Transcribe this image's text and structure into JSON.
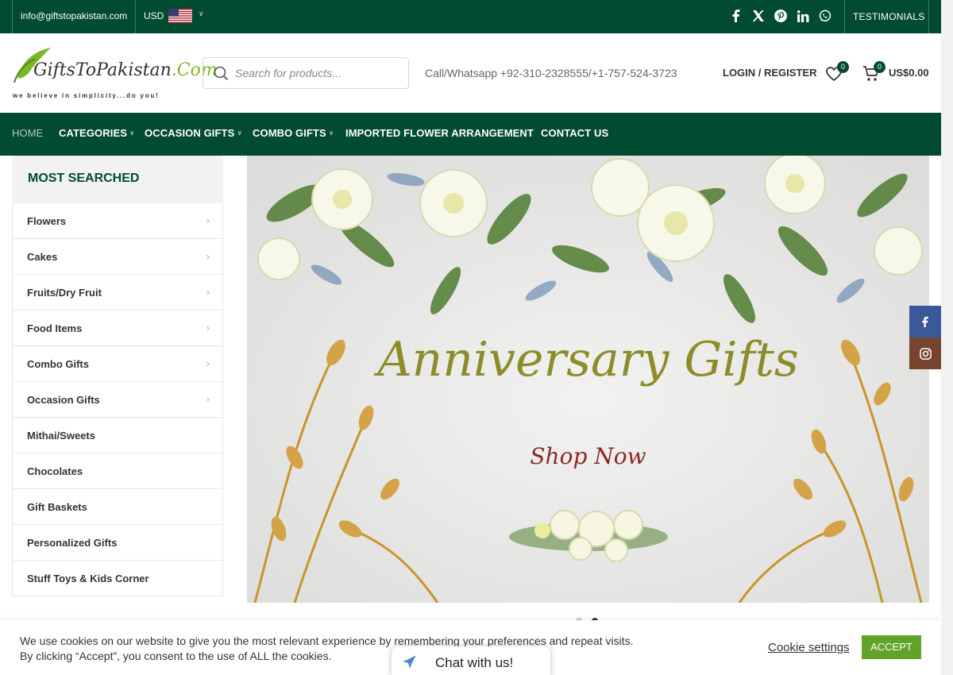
{
  "topbar": {
    "email": "info@giftstopakistan.com",
    "currency": "USD",
    "testimonials": "TESTIMONIALS",
    "social": [
      "facebook-icon",
      "x-icon",
      "pinterest-icon",
      "linkedin-icon",
      "whatsapp-icon"
    ]
  },
  "header": {
    "logo_text": "GiftsToPakistan",
    "logo_com": ".Com",
    "logo_tagline": "we believe in simplicity...do you!",
    "search_placeholder": "Search for products...",
    "call": "Call/Whatsapp +92-310-2328555/+1-757-524-3723",
    "login": "LOGIN / REGISTER",
    "wishlist_count": "0",
    "cart_count": "0",
    "cart_total": "US$0.00"
  },
  "nav": {
    "home": "HOME",
    "categories": "CATEGORIES",
    "occasion": "OCCASION GIFTS",
    "combo": "COMBO GIFTS",
    "imported": "IMPORTED FLOWER ARRANGEMENT",
    "contact": "CONTACT US"
  },
  "sidebar": {
    "title": "MOST SEARCHED",
    "items": [
      {
        "label": "Flowers",
        "has_arrow": true
      },
      {
        "label": "Cakes",
        "has_arrow": true
      },
      {
        "label": "Fruits/Dry Fruit",
        "has_arrow": true
      },
      {
        "label": "Food Items",
        "has_arrow": true
      },
      {
        "label": "Combo Gifts",
        "has_arrow": true
      },
      {
        "label": "Occasion Gifts",
        "has_arrow": true
      },
      {
        "label": "Mithai/Sweets",
        "has_arrow": false
      },
      {
        "label": "Chocolates",
        "has_arrow": false
      },
      {
        "label": "Gift Baskets",
        "has_arrow": false
      },
      {
        "label": "Personalized Gifts",
        "has_arrow": false
      },
      {
        "label": "Stuff Toys & Kids Corner",
        "has_arrow": false
      }
    ]
  },
  "banner": {
    "title": "Anniversary Gifts",
    "cta": "Shop Now"
  },
  "cookie": {
    "message": "We use cookies on our website to give you the most relevant experience by remembering your preferences and repeat visits. By clicking “Accept”, you consent to the use of ALL the cookies.",
    "settings": "Cookie settings",
    "accept": "ACCEPT"
  },
  "chat": {
    "label": "Chat with us!"
  },
  "colors": {
    "brand_green": "#014b31",
    "accept_green": "#61a229",
    "facebook": "#3b5998",
    "instagram": "#774430"
  }
}
